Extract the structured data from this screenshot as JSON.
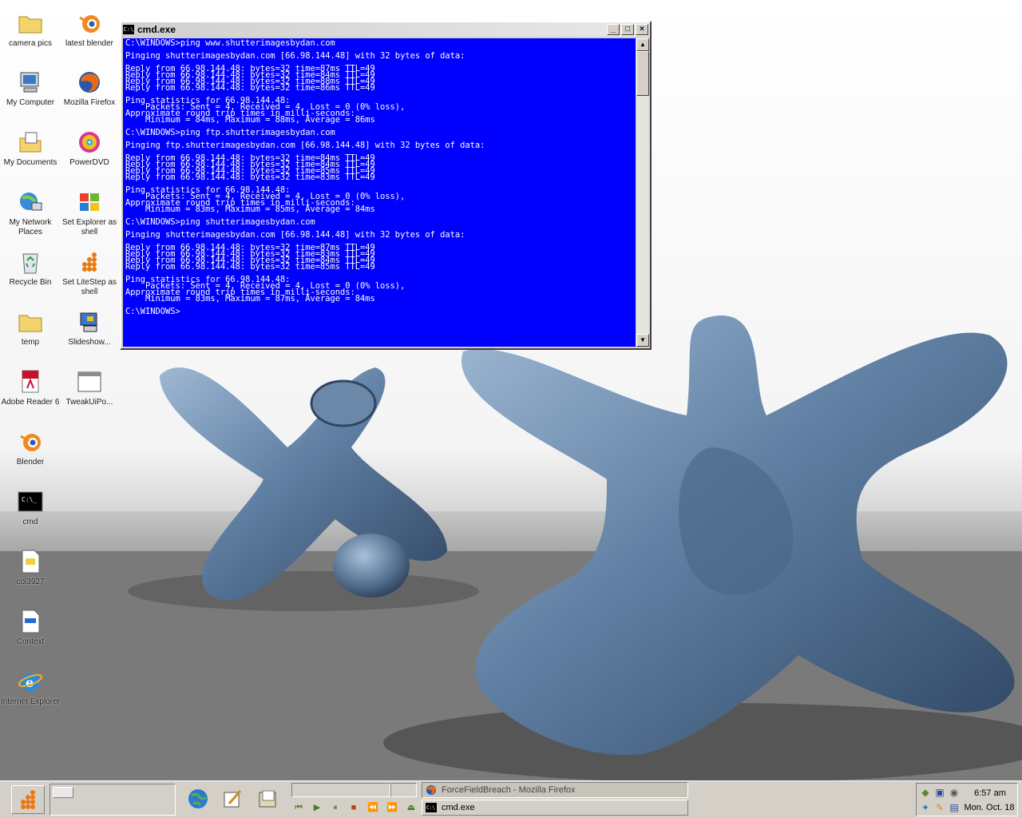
{
  "desktop": {
    "icons": [
      {
        "label": "camera pics",
        "icon": "folder-icon"
      },
      {
        "label": "latest blender",
        "icon": "blender-icon"
      },
      {
        "label": "My Computer",
        "icon": "computer-icon"
      },
      {
        "label": "Mozilla Firefox",
        "icon": "firefox-icon"
      },
      {
        "label": "My Documents",
        "icon": "documents-folder-icon"
      },
      {
        "label": "PowerDVD",
        "icon": "dvd-icon"
      },
      {
        "label": "My Network Places",
        "icon": "network-icon"
      },
      {
        "label": "Set Explorer as shell",
        "icon": "windows-flag-icon"
      },
      {
        "label": "Recycle Bin",
        "icon": "recycle-bin-icon"
      },
      {
        "label": "Set LiteStep as shell",
        "icon": "litestep-icon"
      },
      {
        "label": "temp",
        "icon": "folder-icon"
      },
      {
        "label": "Slideshow...",
        "icon": "slideshow-icon"
      },
      {
        "label": "Adobe Reader 6",
        "icon": "adobe-reader-icon"
      },
      {
        "label": "TweakUiPo...",
        "icon": "window-icon"
      },
      {
        "label": "Blender",
        "icon": "blender-icon"
      },
      {
        "label": "cmd",
        "icon": "console-icon"
      },
      {
        "label": "col3927",
        "icon": "document-icon"
      },
      {
        "label": "Context",
        "icon": "document-icon"
      },
      {
        "label": "Internet Explorer",
        "icon": "internet-explorer-icon"
      }
    ]
  },
  "cmd_window": {
    "title": "cmd.exe",
    "icon_text": "C:\\",
    "minimize": "_",
    "maximize": "□",
    "close": "×",
    "lines": [
      "C:\\WINDOWS>ping www.shutterimagesbydan.com",
      "",
      "Pinging shutterimagesbydan.com [66.98.144.48] with 32 bytes of data:",
      "",
      "Reply from 66.98.144.48: bytes=32 time=87ms TTL=49",
      "Reply from 66.98.144.48: bytes=32 time=84ms TTL=49",
      "Reply from 66.98.144.48: bytes=32 time=88ms TTL=49",
      "Reply from 66.98.144.48: bytes=32 time=86ms TTL=49",
      "",
      "Ping statistics for 66.98.144.48:",
      "    Packets: Sent = 4, Received = 4, Lost = 0 (0% loss),",
      "Approximate round trip times in milli-seconds:",
      "    Minimum = 84ms, Maximum = 88ms, Average = 86ms",
      "",
      "C:\\WINDOWS>ping ftp.shutterimagesbydan.com",
      "",
      "Pinging ftp.shutterimagesbydan.com [66.98.144.48] with 32 bytes of data:",
      "",
      "Reply from 66.98.144.48: bytes=32 time=84ms TTL=49",
      "Reply from 66.98.144.48: bytes=32 time=84ms TTL=49",
      "Reply from 66.98.144.48: bytes=32 time=85ms TTL=49",
      "Reply from 66.98.144.48: bytes=32 time=83ms TTL=49",
      "",
      "Ping statistics for 66.98.144.48:",
      "    Packets: Sent = 4, Received = 4, Lost = 0 (0% loss),",
      "Approximate round trip times in milli-seconds:",
      "    Minimum = 83ms, Maximum = 85ms, Average = 84ms",
      "",
      "C:\\WINDOWS>ping shutterimagesbydan.com",
      "",
      "Pinging shutterimagesbydan.com [66.98.144.48] with 32 bytes of data:",
      "",
      "Reply from 66.98.144.48: bytes=32 time=87ms TTL=49",
      "Reply from 66.98.144.48: bytes=32 time=83ms TTL=49",
      "Reply from 66.98.144.48: bytes=32 time=84ms TTL=49",
      "Reply from 66.98.144.48: bytes=32 time=85ms TTL=49",
      "",
      "Ping statistics for 66.98.144.48:",
      "    Packets: Sent = 4, Received = 4, Lost = 0 (0% loss),",
      "Approximate round trip times in milli-seconds:",
      "    Minimum = 83ms, Maximum = 87ms, Average = 84ms",
      "",
      "C:\\WINDOWS>"
    ],
    "colors": {
      "background": "#0000ff",
      "foreground": "#ffffff"
    }
  },
  "taskbar": {
    "tasks": [
      {
        "label": "ForceFieldBreach - Mozilla Firefox",
        "icon": "firefox-icon"
      },
      {
        "label": "cmd.exe",
        "icon": "console-icon"
      }
    ],
    "media_controls": [
      "previous-icon",
      "play-icon",
      "pause-icon",
      "stop-icon",
      "rewind-icon",
      "forward-icon",
      "eject-icon"
    ],
    "clock": {
      "time": "6:57 am",
      "date": "Mon. Oct. 18"
    }
  }
}
